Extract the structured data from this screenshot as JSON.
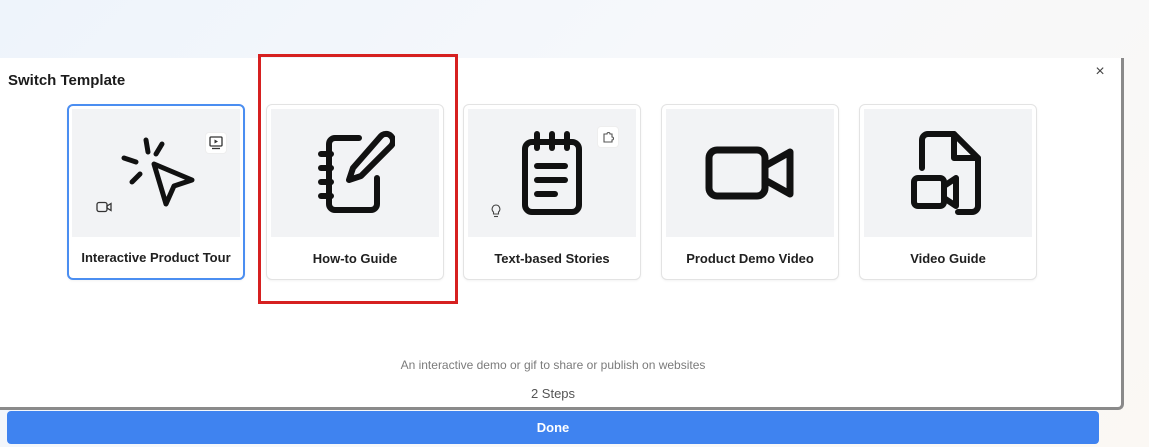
{
  "dialog": {
    "title": "Switch Template",
    "close_label": "×",
    "description": "An interactive demo or gif to share or publish on websites",
    "steps": "2 Steps",
    "done_label": "Done"
  },
  "templates": [
    {
      "label": "Interactive Product Tour",
      "icon": "cursor-click-icon",
      "selected": true
    },
    {
      "label": "How-to Guide",
      "icon": "notebook-pen-icon",
      "selected": false
    },
    {
      "label": "Text-based Stories",
      "icon": "notepad-text-icon",
      "selected": false
    },
    {
      "label": "Product Demo Video",
      "icon": "video-camera-icon",
      "selected": false
    },
    {
      "label": "Video Guide",
      "icon": "file-video-icon",
      "selected": false
    }
  ],
  "colors": {
    "accent": "#3f83f0",
    "selected_border": "#4b8ef1",
    "highlight": "#d62020"
  }
}
